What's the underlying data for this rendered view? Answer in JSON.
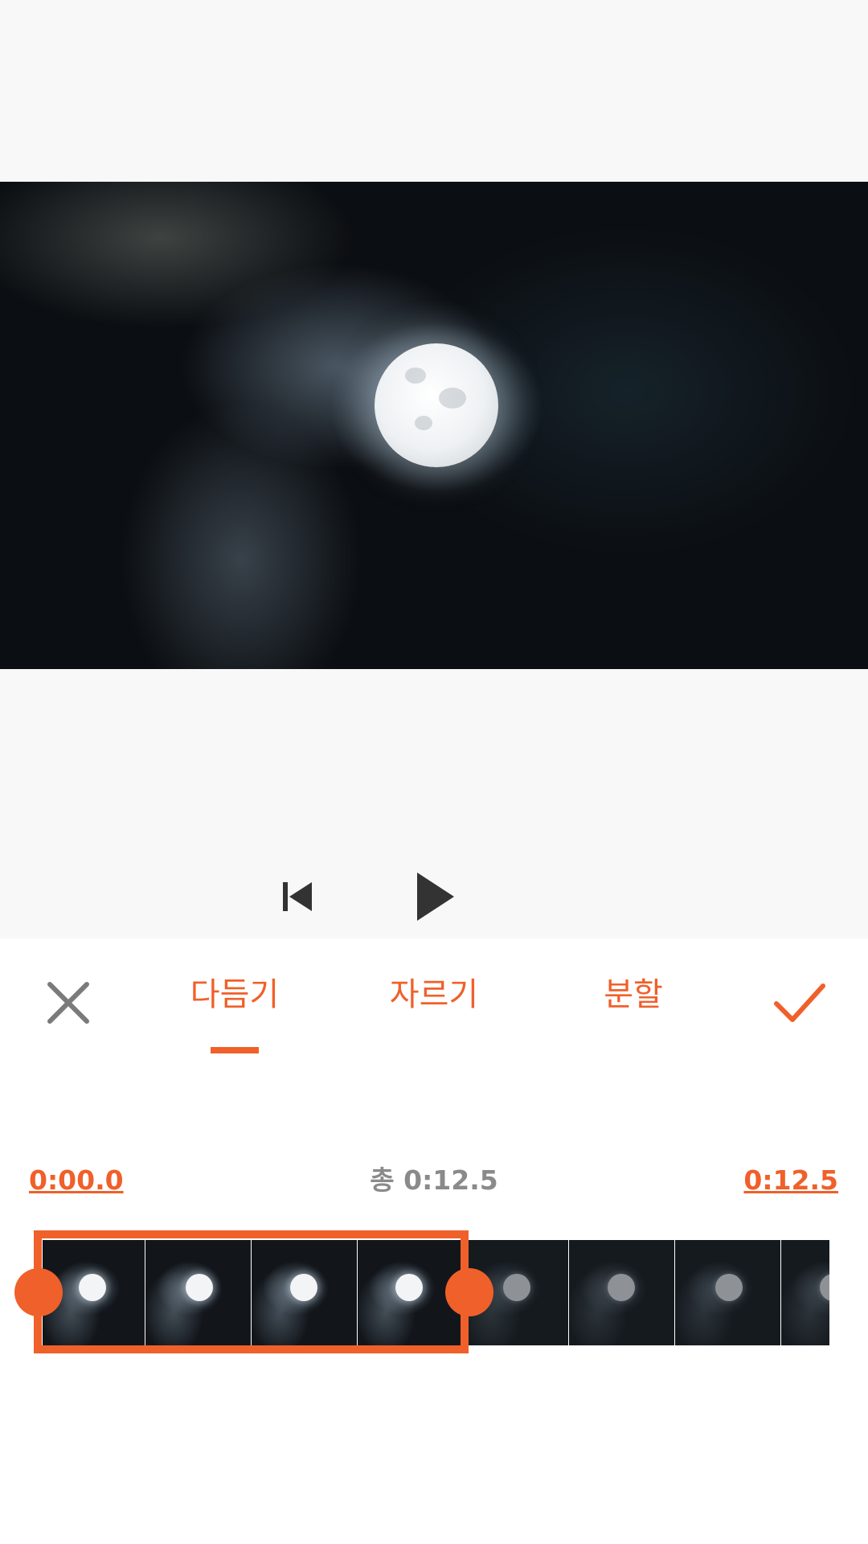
{
  "preview": {
    "video_subject": "moon-in-clouds"
  },
  "playback": {
    "rewind_icon": "skip-to-start-icon",
    "play_icon": "play-icon"
  },
  "edit_bar": {
    "close_icon": "close-icon",
    "confirm_icon": "check-icon",
    "tabs": [
      {
        "label": "다듬기",
        "active": true
      },
      {
        "label": "자르기",
        "active": false
      },
      {
        "label": "분할",
        "active": false
      }
    ]
  },
  "trim": {
    "start_time": "0:00.0",
    "total_label": "총 0:12.5",
    "end_time": "0:12.5"
  },
  "colors": {
    "accent": "#f0602a",
    "muted_text": "#8a8a8a",
    "icon_dark": "#333333",
    "icon_gray": "#7a7a7a"
  }
}
